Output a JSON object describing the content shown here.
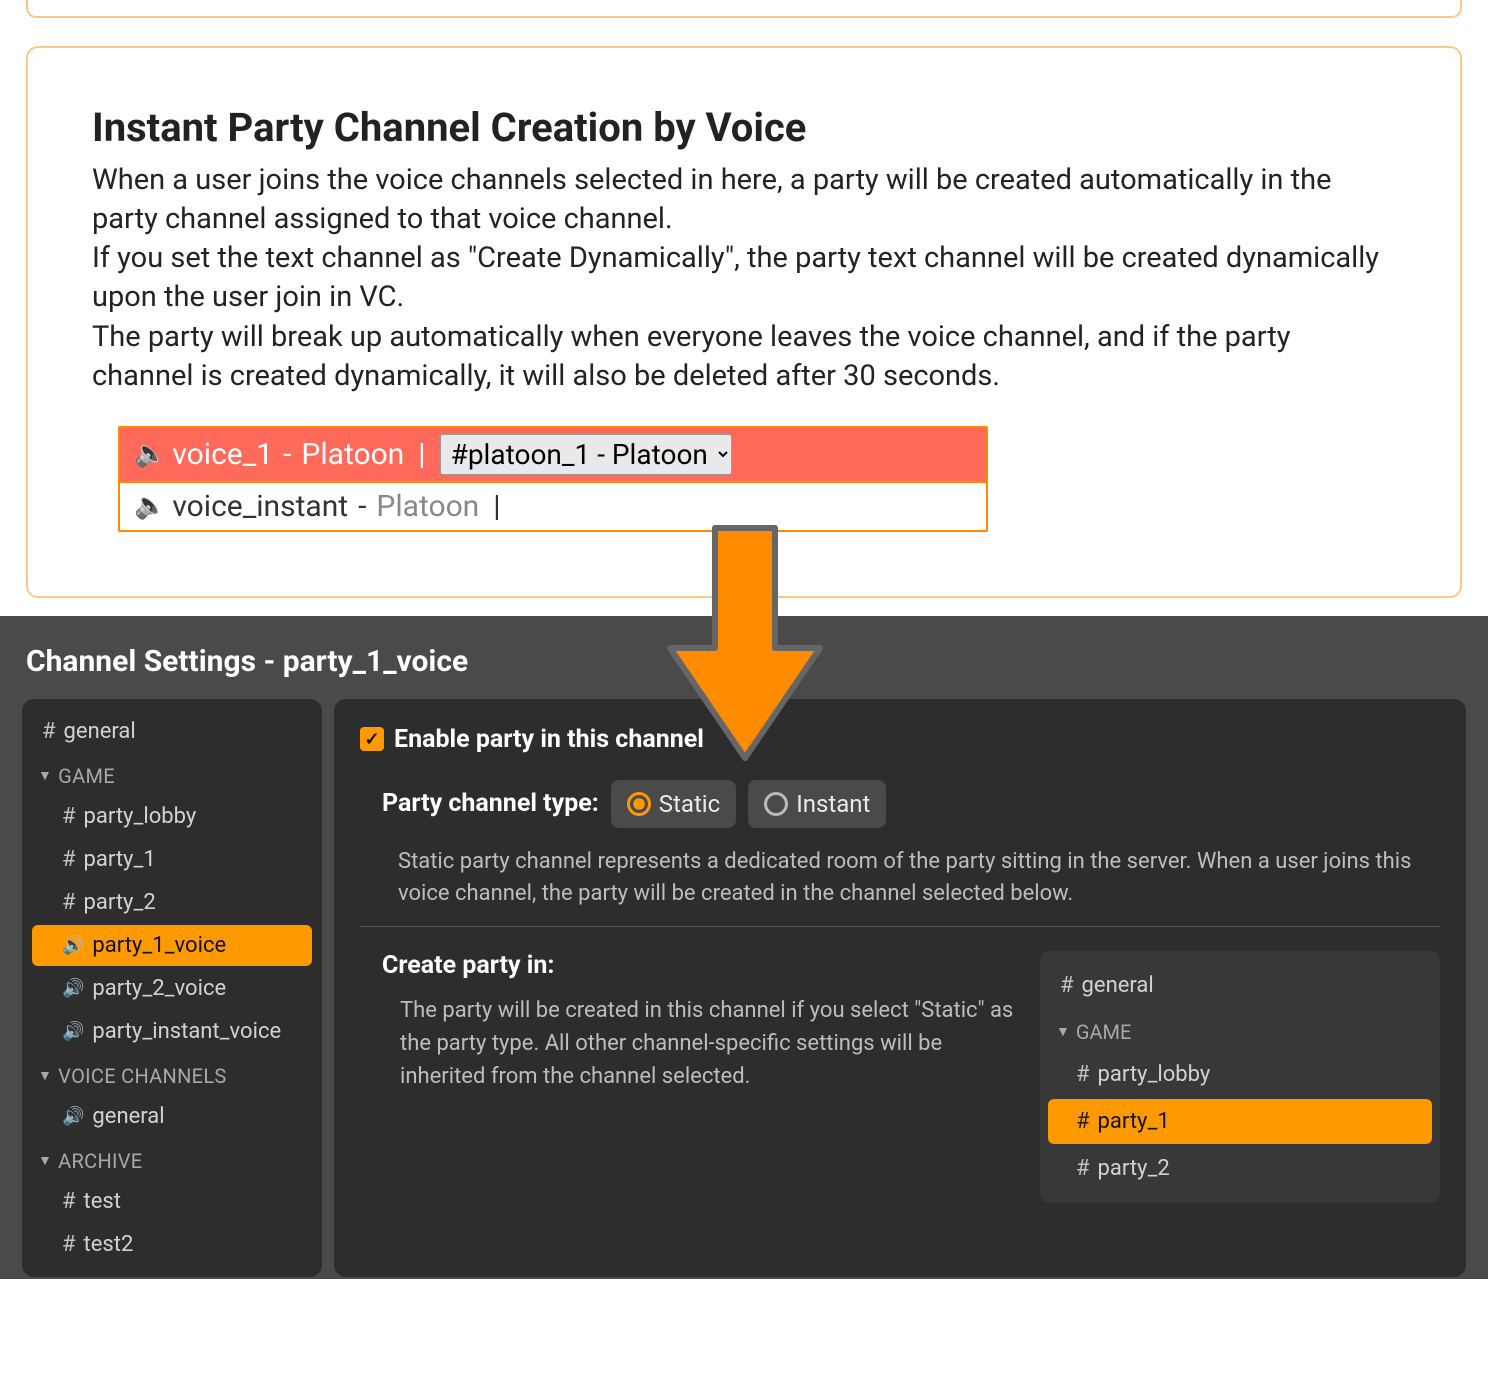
{
  "card": {
    "title": "Instant Party Channel Creation by Voice",
    "p1": "When a user joins the voice channels selected in here, a party will be created automatically in the party channel assigned to that voice channel.",
    "p2": "If you set the text channel as \"Create Dynamically\", the party text channel will be created dynamically upon the user join in VC.",
    "p3": "The party will break up automatically when everyone leaves the voice channel, and if the party channel is created dynamically, it will also be deleted after 30 seconds."
  },
  "voiceRows": {
    "row1": {
      "voice": "voice_1",
      "party": "Platoon",
      "select": "#platoon_1 - Platoon"
    },
    "row2": {
      "voice": "voice_instant",
      "party": "Platoon"
    }
  },
  "settings": {
    "title": "Channel Settings - party_1_voice",
    "enableLabel": "Enable party in this channel",
    "typeLabel": "Party channel type:",
    "staticLabel": "Static",
    "instantLabel": "Instant",
    "staticDesc": "Static party channel represents a dedicated room of the party sitting in the server. When a user joins this voice channel, the party will be created in the channel selected below.",
    "createHeading": "Create party in:",
    "createDesc": "The party will be created in this channel if you select \"Static\" as the party type. All other channel-specific settings will be inherited from the channel selected."
  },
  "sidebar": {
    "general": "general",
    "catGame": "GAME",
    "party_lobby": "party_lobby",
    "party_1": "party_1",
    "party_2": "party_2",
    "party_1_voice": "party_1_voice",
    "party_2_voice": "party_2_voice",
    "party_instant_voice": "party_instant_voice",
    "catVoice": "VOICE CHANNELS",
    "voice_general": "general",
    "catArchive": "ARCHIVE",
    "test": "test",
    "test2": "test2"
  },
  "miniTree": {
    "general": "general",
    "catGame": "GAME",
    "party_lobby": "party_lobby",
    "party_1": "party_1",
    "party_2": "party_2"
  }
}
